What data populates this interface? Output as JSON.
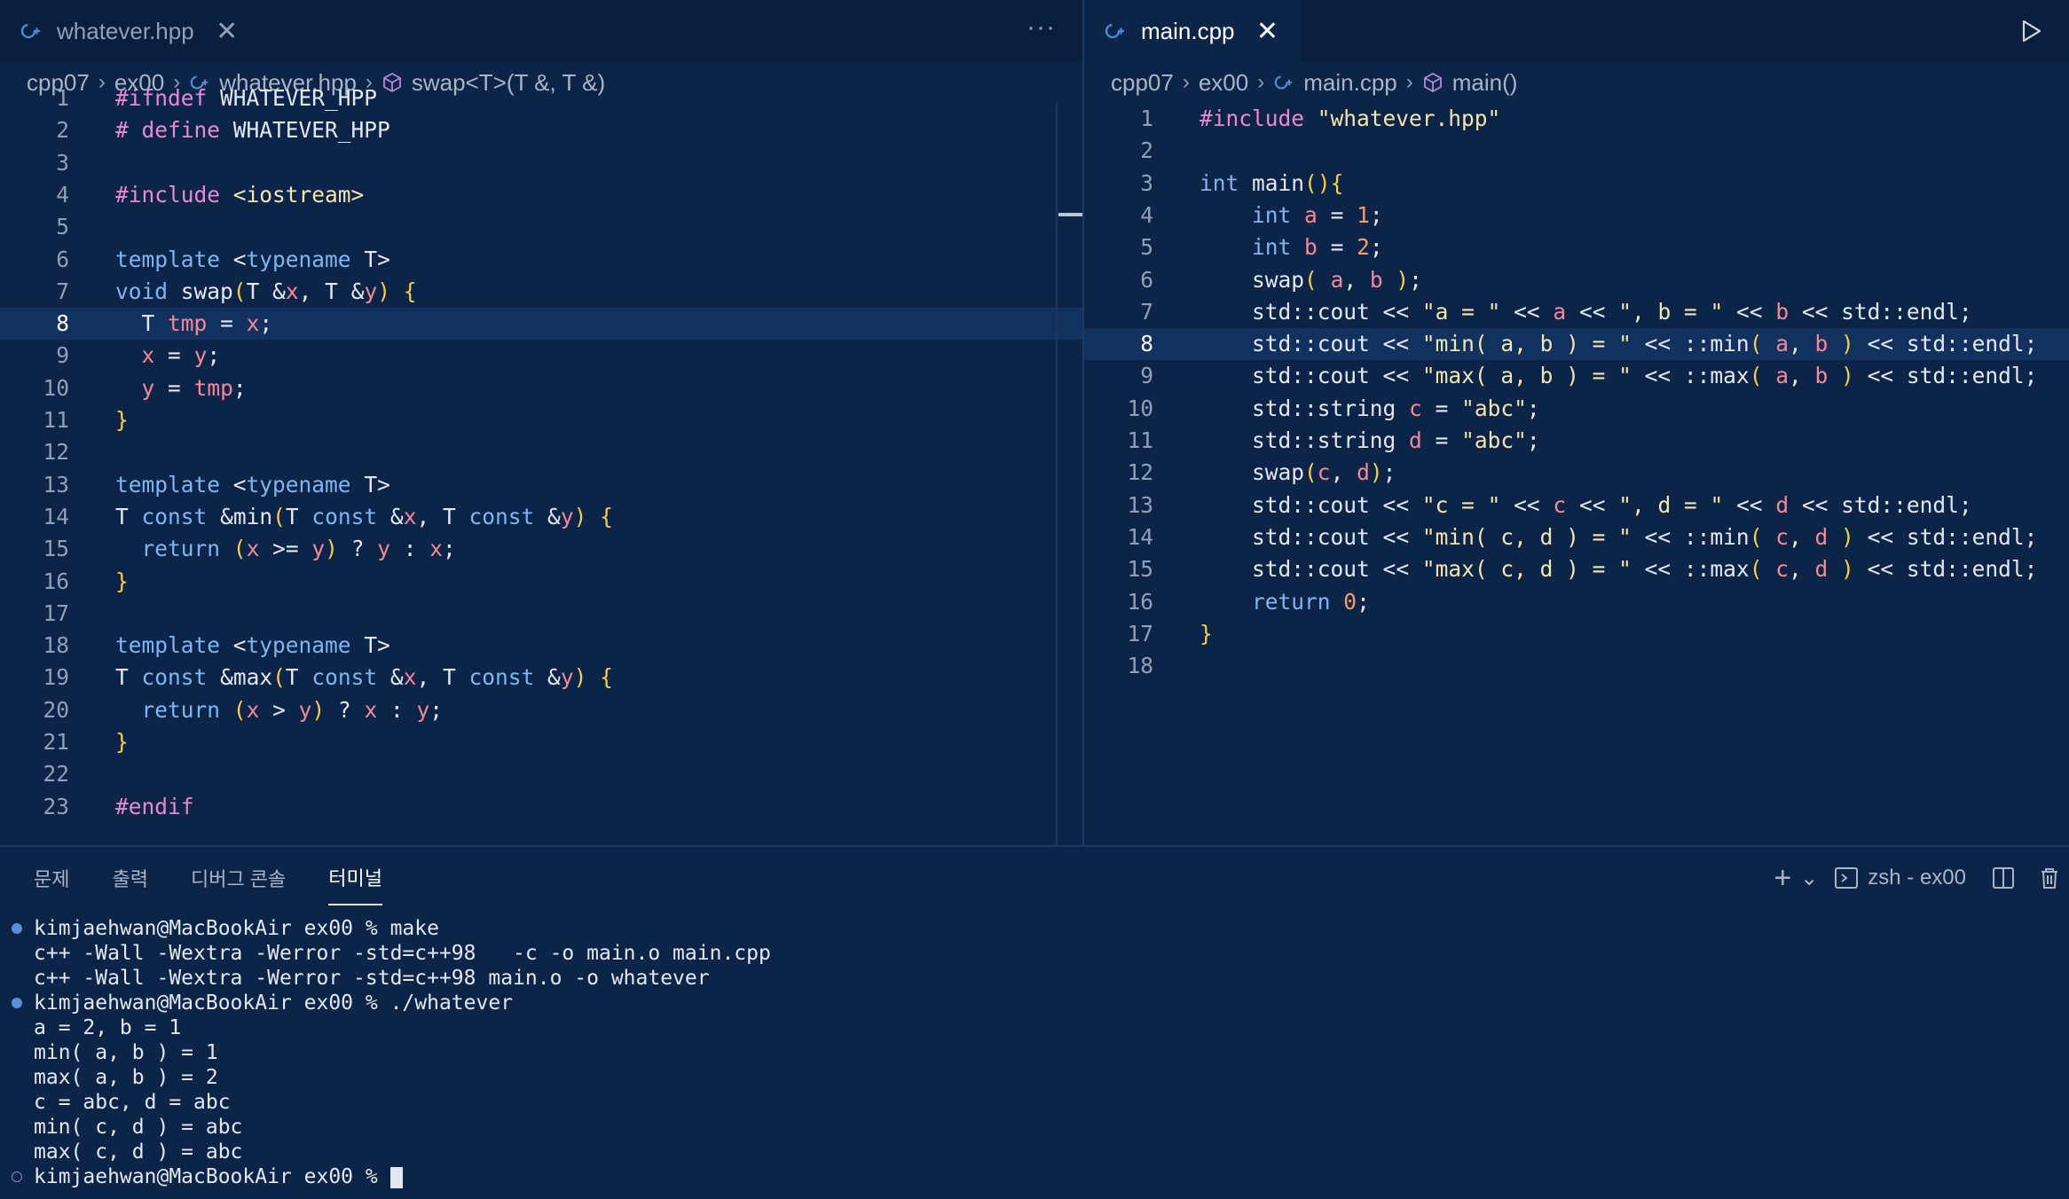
{
  "left_editor": {
    "tab": {
      "label": "whatever.hpp",
      "close": "✕",
      "file_icon": "cpp-header-icon"
    },
    "more_actions": "···",
    "breadcrumb": [
      "cpp07",
      "ex00",
      "whatever.hpp",
      "swap<T>(T &, T &)"
    ],
    "first_line_partial": "#ifndef WHATEVER_HPP",
    "lines": [
      {
        "n": "1",
        "text": "#ifndef WHATEVER_HPP"
      },
      {
        "n": "2",
        "text": "# define WHATEVER_HPP"
      },
      {
        "n": "3",
        "text": ""
      },
      {
        "n": "4",
        "text": "#include <iostream>"
      },
      {
        "n": "5",
        "text": ""
      },
      {
        "n": "6",
        "text": "template <typename T>"
      },
      {
        "n": "7",
        "text": "void swap(T &x, T &y) {"
      },
      {
        "n": "8",
        "text": "  T tmp = x;"
      },
      {
        "n": "9",
        "text": "  x = y;"
      },
      {
        "n": "10",
        "text": "  y = tmp;"
      },
      {
        "n": "11",
        "text": "}"
      },
      {
        "n": "12",
        "text": ""
      },
      {
        "n": "13",
        "text": "template <typename T>"
      },
      {
        "n": "14",
        "text": "T const &min(T const &x, T const &y) {"
      },
      {
        "n": "15",
        "text": "  return (x >= y) ? y : x;"
      },
      {
        "n": "16",
        "text": "}"
      },
      {
        "n": "17",
        "text": ""
      },
      {
        "n": "18",
        "text": "template <typename T>"
      },
      {
        "n": "19",
        "text": "T const &max(T const &x, T const &y) {"
      },
      {
        "n": "20",
        "text": "  return (x > y) ? x : y;"
      },
      {
        "n": "21",
        "text": "}"
      },
      {
        "n": "22",
        "text": ""
      },
      {
        "n": "23",
        "text": "#endif"
      }
    ]
  },
  "right_editor": {
    "tab": {
      "label": "main.cpp",
      "close": "✕",
      "file_icon": "cpp-file-icon"
    },
    "run_icon": "play-icon",
    "breadcrumb": [
      "cpp07",
      "ex00",
      "main.cpp",
      "main()"
    ],
    "lines": [
      {
        "n": "1",
        "text": "#include \"whatever.hpp\""
      },
      {
        "n": "2",
        "text": ""
      },
      {
        "n": "3",
        "text": "int main(){"
      },
      {
        "n": "4",
        "text": "    int a = 1;"
      },
      {
        "n": "5",
        "text": "    int b = 2;"
      },
      {
        "n": "6",
        "text": "    swap( a, b );"
      },
      {
        "n": "7",
        "text": "    std::cout << \"a = \" << a << \", b = \" << b << std::endl;"
      },
      {
        "n": "8",
        "text": "    std::cout << \"min( a, b ) = \" << ::min( a, b ) << std::endl;"
      },
      {
        "n": "9",
        "text": "    std::cout << \"max( a, b ) = \" << ::max( a, b ) << std::endl;"
      },
      {
        "n": "10",
        "text": "    std::string c = \"abc\";"
      },
      {
        "n": "11",
        "text": "    std::string d = \"abc\";"
      },
      {
        "n": "12",
        "text": "    swap(c, d);"
      },
      {
        "n": "13",
        "text": "    std::cout << \"c = \" << c << \", d = \" << d << std::endl;"
      },
      {
        "n": "14",
        "text": "    std::cout << \"min( c, d ) = \" << ::min( c, d ) << std::endl;"
      },
      {
        "n": "15",
        "text": "    std::cout << \"max( c, d ) = \" << ::max( c, d ) << std::endl;"
      },
      {
        "n": "16",
        "text": "    return 0;"
      },
      {
        "n": "17",
        "text": "}"
      },
      {
        "n": "18",
        "text": ""
      }
    ]
  },
  "panel": {
    "tabs": [
      "문제",
      "출력",
      "디버그 콘솔",
      "터미널"
    ],
    "active_tab": "터미널",
    "actions": {
      "new_terminal": "+",
      "dropdown": "⌄",
      "terminal_name": "zsh - ex00"
    },
    "terminal_lines": [
      {
        "dot": "filled",
        "text": "kimjaehwan@MacBookAir ex00 % make"
      },
      {
        "dot": "",
        "text": "c++ -Wall -Wextra -Werror -std=c++98   -c -o main.o main.cpp"
      },
      {
        "dot": "",
        "text": "c++ -Wall -Wextra -Werror -std=c++98 main.o -o whatever"
      },
      {
        "dot": "filled",
        "text": "kimjaehwan@MacBookAir ex00 % ./whatever"
      },
      {
        "dot": "",
        "text": "a = 2, b = 1"
      },
      {
        "dot": "",
        "text": "min( a, b ) = 1"
      },
      {
        "dot": "",
        "text": "max( a, b ) = 2"
      },
      {
        "dot": "",
        "text": "c = abc, d = abc"
      },
      {
        "dot": "",
        "text": "min( c, d ) = abc"
      },
      {
        "dot": "",
        "text": "max( c, d ) = abc"
      },
      {
        "dot": "hollow",
        "text": "kimjaehwan@MacBookAir ex00 % "
      }
    ]
  },
  "colors": {
    "background": "#0c2447",
    "tabbar": "#0a1f3d",
    "highlight_line": "#12315e",
    "keyword": "#7fb6f2",
    "preprocessor": "#e58ad8",
    "string": "#f0e6b0",
    "number": "#f29f6b",
    "bracket": "#f2d04c"
  }
}
